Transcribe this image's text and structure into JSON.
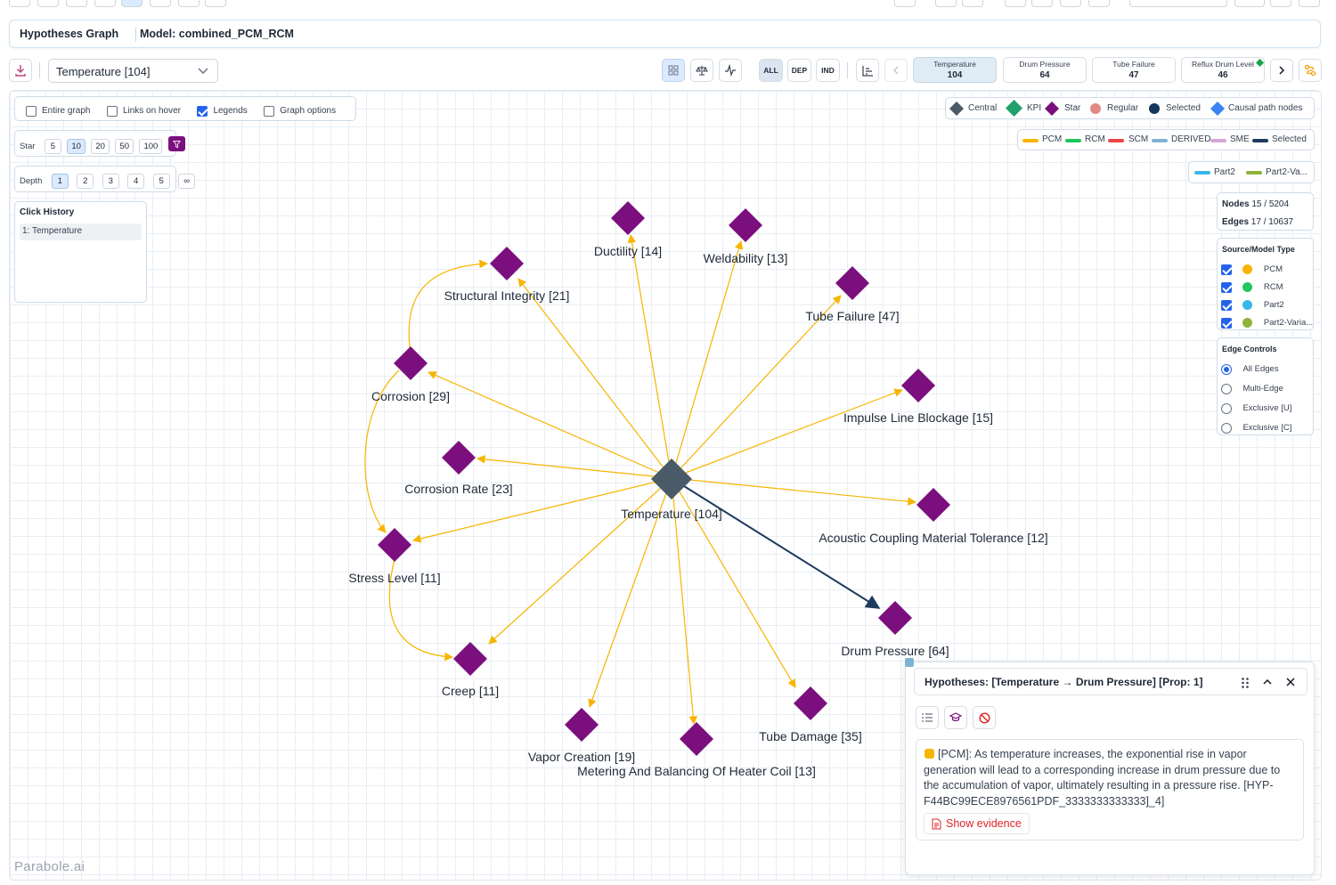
{
  "header": {
    "title": "Hypotheses Graph",
    "model_label": "Model: combined_PCM_RCM"
  },
  "toolbar": {
    "node_select": "Temperature [104]",
    "filters": [
      "ALL",
      "DEP",
      "IND"
    ],
    "tabs": [
      {
        "label": "Temperature",
        "value": "104"
      },
      {
        "label": "Drum Pressure",
        "value": "64"
      },
      {
        "label": "Tube Failure",
        "value": "47"
      },
      {
        "label": "Reflux Drum Level",
        "value": "46"
      }
    ]
  },
  "options": {
    "entire_graph": "Entire graph",
    "links_on_hover": "Links on hover",
    "legends": "Legends",
    "graph_options": "Graph options"
  },
  "star": {
    "label": "Star",
    "values": [
      "5",
      "10",
      "20",
      "50",
      "100"
    ],
    "selected": "10"
  },
  "depth": {
    "label": "Depth",
    "values": [
      "1",
      "2",
      "3",
      "4",
      "5",
      "∞"
    ],
    "selected": "1"
  },
  "click_history": {
    "title": "Click History",
    "items": [
      "1: Temperature"
    ]
  },
  "legend_nodes": [
    "Central",
    "KPI",
    "Star",
    "Regular",
    "Selected",
    "Causal path nodes"
  ],
  "legend_edges": [
    {
      "label": "PCM",
      "color": "#f7b500"
    },
    {
      "label": "RCM",
      "color": "#22c55e"
    },
    {
      "label": "SCM",
      "color": "#ef4444"
    },
    {
      "label": "DERIVED",
      "color": "#7fb3d5"
    },
    {
      "label": "SME",
      "color": "#d4a5d4"
    },
    {
      "label": "Selected",
      "color": "#1e3a5f"
    }
  ],
  "legend_parts": [
    {
      "label": "Part2",
      "color": "#38b6e8"
    },
    {
      "label": "Part2-Va...",
      "color": "#8db33a"
    }
  ],
  "stats": {
    "nodes_label": "Nodes",
    "nodes_value": "15",
    "nodes_total": "5204",
    "edges_label": "Edges",
    "edges_value": "17",
    "edges_total": "10637"
  },
  "source_types": {
    "title": "Source/Model Type",
    "items": [
      {
        "label": "PCM",
        "color": "#f7b500"
      },
      {
        "label": "RCM",
        "color": "#22c55e"
      },
      {
        "label": "Part2",
        "color": "#38b6e8"
      },
      {
        "label": "Part2-Varia...",
        "color": "#8db33a"
      }
    ]
  },
  "edge_controls": {
    "title": "Edge Controls",
    "options": [
      "All Edges",
      "Multi-Edge",
      "Exclusive [U]",
      "Exclusive [C]"
    ],
    "selected": "All Edges"
  },
  "graph": {
    "central": "Temperature [104]",
    "nodes": [
      "Ductility [14]",
      "Weldability [13]",
      "Structural Integrity [21]",
      "Tube Failure [47]",
      "Corrosion [29]",
      "Impulse Line Blockage [15]",
      "Corrosion Rate [23]",
      "Acoustic Coupling Material Tolerance [12]",
      "Stress Level [11]",
      "Drum Pressure [64]",
      "Creep [11]",
      "Tube Damage [35]",
      "Vapor Creation [19]",
      "Metering And Balancing Of Heater Coil [13]"
    ]
  },
  "hypothesis": {
    "title": "Hypotheses: [Temperature → Drum Pressure] [Prop: 1]",
    "text": "[PCM]: As temperature increases, the exponential rise in vapor generation will lead to a corresponding increase in drum pressure due to the accumulation of vapor, ultimately resulting in a pressure rise. [HYP-F44BC99ECE8976561PDF_3333333333333]_4]",
    "evidence_button": "Show evidence"
  },
  "brand": "Parabole.ai",
  "colors": {
    "pcm_edge": "#f7b500",
    "selected_edge": "#1e3a5f",
    "star_node": "#7b0f7e",
    "central_node": "#4a5a68"
  }
}
